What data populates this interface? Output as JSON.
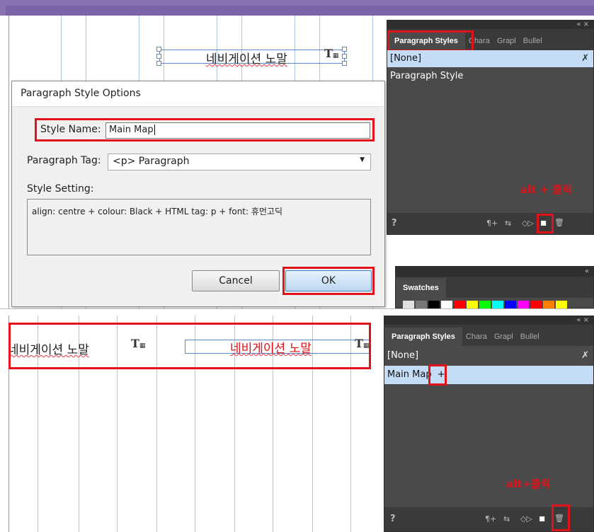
{
  "nav_text": "네비게이션 노말",
  "dialog": {
    "title": "Paragraph Style Options",
    "style_name_label": "Style Name:",
    "style_name_value": "Main Map",
    "paragraph_tag_label": "Paragraph Tag:",
    "paragraph_tag_value": "<p> Paragraph",
    "style_setting_label": "Style Setting:",
    "style_setting_value": "align: centre + colour: Black + HTML tag: p + font: 휴먼고딕",
    "cancel_label": "Cancel",
    "ok_label": "OK"
  },
  "panel_top": {
    "collapse": "«  ×",
    "tabs": [
      "Paragraph Styles",
      "Chara",
      "Grapl",
      "Bullel"
    ],
    "rows": [
      "[None]",
      "Paragraph Style"
    ],
    "annotation": "alt + 클릭",
    "footer_icons": [
      "¶+",
      "⇆",
      "◇▷",
      "▪",
      "🗑"
    ],
    "help": "?"
  },
  "swatches": {
    "collapse": "«",
    "tab": "Swatches",
    "colors": [
      "#e0e0e0",
      "#777777",
      "#000000",
      "#ffffff",
      "#ff0000",
      "#ffff00",
      "#00ff00",
      "#00ffff",
      "#0000ff",
      "#ff00ff",
      "#ff0000",
      "#ff7f00",
      "#ffff00"
    ]
  },
  "panel_bottom": {
    "collapse": "«  ×",
    "tabs": [
      "Paragraph Styles",
      "Chara",
      "Grapl",
      "Bullel"
    ],
    "rows": [
      "[None]",
      "Main Map"
    ],
    "plus": "+",
    "annotation": "alt+클릭",
    "footer_icons": [
      "¶+",
      "⇆",
      "◇▷",
      "▪",
      "🗑"
    ],
    "help": "?"
  },
  "accent": {
    "red": "#e0121a",
    "guide": "#a9c9e6",
    "frame": "#5a87c5"
  }
}
